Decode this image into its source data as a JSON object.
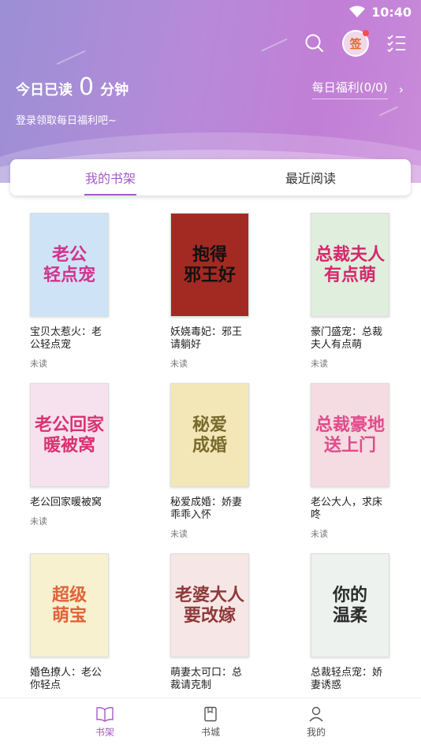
{
  "status_bar": {
    "time": "10:40"
  },
  "header": {
    "read_prefix": "今日已读",
    "read_minutes": "0",
    "read_suffix": "分钟",
    "login_tip": "登录领取每日福利吧~",
    "welfare_label": "每日福利(0/0)",
    "sign_label": "签"
  },
  "tabs": [
    {
      "label": "我的书架",
      "active": true
    },
    {
      "label": "最近阅读",
      "active": false
    }
  ],
  "books": [
    {
      "title": "宝贝太惹火：老公轻点宠",
      "status": "未读",
      "cover_text": "老公\n轻点宠",
      "cover_bg": "#cfe3f6",
      "cover_color": "#d0338d"
    },
    {
      "title": "妖娆毒妃：邪王请躺好",
      "status": "未读",
      "cover_text": "抱得\n邪王好",
      "cover_bg": "#a32a22",
      "cover_color": "#111111"
    },
    {
      "title": "豪门盛宠：总裁夫人有点萌",
      "status": "未读",
      "cover_text": "总裁夫人\n有点萌",
      "cover_bg": "#dfeedd",
      "cover_color": "#d6276b"
    },
    {
      "title": "老公回家暖被窝",
      "status": "未读",
      "cover_text": "老公回家\n暖被窝",
      "cover_bg": "#f6e2ee",
      "cover_color": "#d9336f"
    },
    {
      "title": "秘爱成婚：娇妻乖乖入怀",
      "status": "未读",
      "cover_text": "秘爱\n成婚",
      "cover_bg": "#f3e7b8",
      "cover_color": "#7a6b2c"
    },
    {
      "title": "老公大人，求床咚",
      "status": "未读",
      "cover_text": "总裁豪地\n送上门",
      "cover_bg": "#f4dce2",
      "cover_color": "#e14b8b"
    },
    {
      "title": "婚色撩人：老公你轻点",
      "status": "",
      "cover_text": "超级\n萌宝",
      "cover_bg": "#f7f1d0",
      "cover_color": "#e0643a"
    },
    {
      "title": "萌妻太可口：总裁请克制",
      "status": "",
      "cover_text": "老婆大人\n要改嫁",
      "cover_bg": "#f7e6e6",
      "cover_color": "#8e3a3a"
    },
    {
      "title": "总裁轻点宠：娇妻诱惑",
      "status": "",
      "cover_text": "你的\n温柔",
      "cover_bg": "#eef2ef",
      "cover_color": "#2b2b2b"
    }
  ],
  "bottom_nav": [
    {
      "label": "书架",
      "icon": "book-open-icon",
      "active": true
    },
    {
      "label": "书城",
      "icon": "bookstore-icon",
      "active": false
    },
    {
      "label": "我的",
      "icon": "user-icon",
      "active": false
    }
  ],
  "colors": {
    "accent": "#a45cc7",
    "header_start": "#9b8fd6",
    "header_end": "#c98bd9"
  }
}
